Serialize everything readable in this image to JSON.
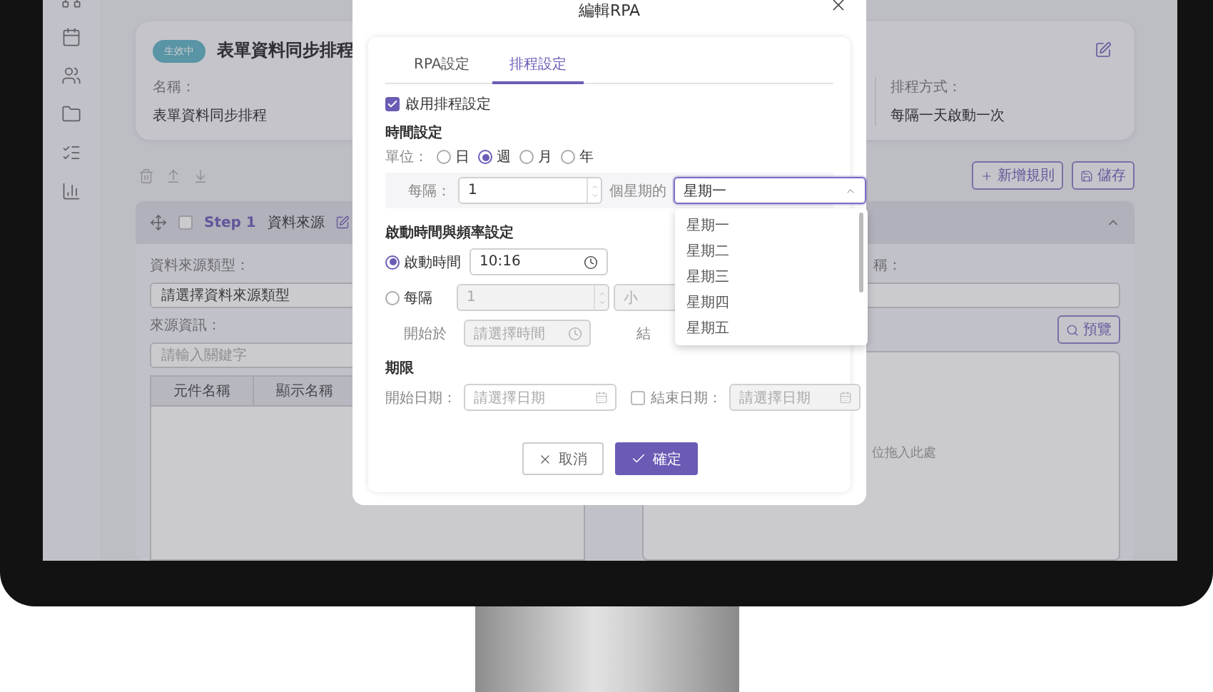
{
  "header_card": {
    "status": "生效中",
    "title": "表單資料同步排程",
    "fields": [
      {
        "label": "名稱：",
        "value": "表單資料同步排程"
      },
      {
        "label": "排程方式：",
        "value": "每隔一天啟動一次"
      }
    ]
  },
  "toolbar": {
    "buttons": [
      {
        "kind": "add",
        "label": "新增規則"
      },
      {
        "kind": "save",
        "label": "儲存"
      }
    ]
  },
  "step": {
    "checked": false,
    "number": "Step 1",
    "title": "資料來源",
    "expanded": true
  },
  "left_form": {
    "source_type_label": "資料來源類型：",
    "source_type_placeholder": "請選擇資料來源類型",
    "source_info_label": "來源資訊：",
    "source_info_placeholder": "請輸入關鍵字",
    "table_columns": [
      "元件名稱",
      "顯示名稱"
    ]
  },
  "right_form": {
    "label": "稱：",
    "preview_button": "預覽",
    "drop_hint": "位拖入此處"
  },
  "dialog": {
    "title": "編輯RPA",
    "tabs": [
      {
        "label": "RPA設定",
        "selected": false
      },
      {
        "label": "排程設定",
        "selected": true
      }
    ],
    "enable_schedule": {
      "label": "啟用排程設定",
      "checked": true
    },
    "time_settings": {
      "heading": "時間設定",
      "unit_label": "單位：",
      "units": [
        {
          "label": "日",
          "selected": false
        },
        {
          "label": "週",
          "selected": true
        },
        {
          "label": "月",
          "selected": false
        },
        {
          "label": "年",
          "selected": false
        }
      ],
      "every_label": "每隔：",
      "every_value": "1",
      "week_suffix": "個星期的",
      "weekday": {
        "value": "星期一",
        "expanded": true,
        "options": [
          "星期一",
          "星期二",
          "星期三",
          "星期四",
          "星期五"
        ]
      }
    },
    "frequency": {
      "heading": "啟動時間與頻率設定",
      "modes": [
        {
          "kind": "time",
          "label": "啟動時間",
          "selected": true,
          "value": "10:16"
        },
        {
          "kind": "interval",
          "label": "每隔",
          "selected": false,
          "disabled": true,
          "value": "1",
          "unit": "小",
          "start_label": "開始於",
          "start_placeholder": "請選擇時間",
          "end_label": "結"
        }
      ]
    },
    "period": {
      "heading": "期限",
      "start_label": "開始日期：",
      "start_placeholder": "請選擇日期",
      "end": {
        "label": "結束日期：",
        "checked": false,
        "placeholder": "請選擇日期"
      }
    },
    "buttons": [
      {
        "kind": "cancel",
        "label": "取消"
      },
      {
        "kind": "confirm",
        "label": "確定"
      }
    ]
  }
}
